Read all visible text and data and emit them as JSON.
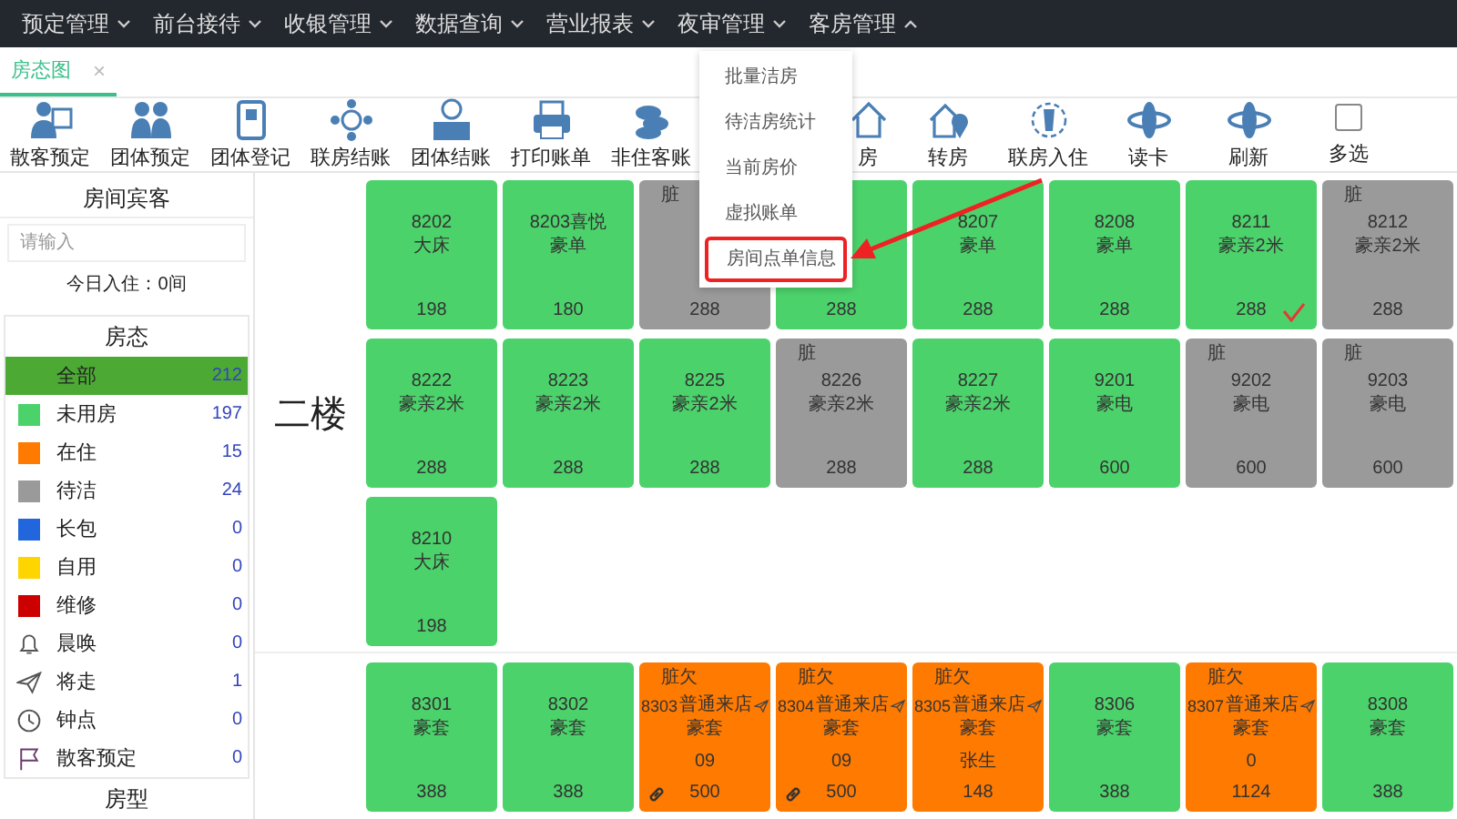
{
  "nav": [
    {
      "label": "预定管理",
      "expanded": false
    },
    {
      "label": "前台接待",
      "expanded": false
    },
    {
      "label": "收银管理",
      "expanded": false
    },
    {
      "label": "数据查询",
      "expanded": false
    },
    {
      "label": "营业报表",
      "expanded": false
    },
    {
      "label": "夜审管理",
      "expanded": false
    },
    {
      "label": "客房管理",
      "expanded": true
    }
  ],
  "tabs": [
    {
      "label": "房态图",
      "selected": true,
      "close": "×"
    }
  ],
  "toolbar": [
    {
      "kind": "button",
      "label": "散客预定"
    },
    {
      "kind": "button",
      "label": "团体预定"
    },
    {
      "kind": "button",
      "label": "团体登记"
    },
    {
      "kind": "button",
      "label": "联房结账"
    },
    {
      "kind": "button",
      "label": "团体结账"
    },
    {
      "kind": "button",
      "label": "打印账单"
    },
    {
      "kind": "button",
      "label": "非住客账"
    },
    {
      "kind": "button",
      "label": "房"
    },
    {
      "kind": "button",
      "label": "转房"
    },
    {
      "kind": "button",
      "label": "联房入住"
    },
    {
      "kind": "button",
      "label": "读卡"
    },
    {
      "kind": "button",
      "label": "刷新"
    },
    {
      "kind": "checkbox",
      "label": "多选",
      "checked": false
    }
  ],
  "menu": {
    "items": [
      {
        "label": "批量洁房",
        "annotated": false
      },
      {
        "label": "待洁房统计",
        "annotated": false
      },
      {
        "label": "当前房价",
        "annotated": false
      },
      {
        "label": "虚拟账单",
        "annotated": false
      },
      {
        "label": "房间点单信息",
        "annotated": true
      }
    ]
  },
  "annotations": [
    {
      "kind": "arrow"
    }
  ],
  "sidebar": {
    "title": "房间宾客",
    "search": {
      "placeholder": "请输入"
    },
    "today": "今日入住：0间",
    "status_title": "房态",
    "statuses": [
      {
        "kind": "plain",
        "label": "全部",
        "count": "212",
        "selected": true
      },
      {
        "kind": "swatch",
        "label": "未用房",
        "count": "197",
        "color": "#4cd26b",
        "selected": false
      },
      {
        "kind": "swatch",
        "label": "在住",
        "count": "15",
        "color": "#ff7a00",
        "selected": false
      },
      {
        "kind": "swatch",
        "label": "待洁",
        "count": "24",
        "color": "#9a9a9a",
        "selected": false
      },
      {
        "kind": "swatch",
        "label": "长包",
        "count": "0",
        "color": "#2266dd",
        "selected": false
      },
      {
        "kind": "swatch",
        "label": "自用",
        "count": "0",
        "color": "#ffd500",
        "selected": false
      },
      {
        "kind": "swatch",
        "label": "维修",
        "count": "0",
        "color": "#cc0000",
        "selected": false
      },
      {
        "kind": "bell",
        "label": "晨唤",
        "count": "0",
        "selected": false
      },
      {
        "kind": "plane",
        "label": "将走",
        "count": "1",
        "selected": false
      },
      {
        "kind": "clock",
        "label": "钟点",
        "count": "0",
        "selected": false
      },
      {
        "kind": "flag",
        "label": "散客预定",
        "count": "0",
        "selected": false
      }
    ],
    "type_title": "房型"
  },
  "floors": [
    {
      "label": "二楼",
      "rooms": [
        {
          "color": "#4cd26b",
          "number": "8202",
          "type": "大床",
          "price": "198"
        },
        {
          "color": "#4cd26b",
          "number": "8203喜悦",
          "type": "豪单",
          "price": "180"
        },
        {
          "color": "#9a9a9a",
          "tag": "脏",
          "price": "288"
        },
        {
          "color": "#4cd26b",
          "price": "288"
        },
        {
          "color": "#4cd26b",
          "number": "8207",
          "type": "豪单",
          "price": "288"
        },
        {
          "color": "#4cd26b",
          "number": "8208",
          "type": "豪单",
          "price": "288"
        },
        {
          "color": "#4cd26b",
          "number": "8211",
          "type": "豪亲2米",
          "price": "288",
          "checked": true
        },
        {
          "color": "#9a9a9a",
          "tag": "脏",
          "number": "8212",
          "type": "豪亲2米",
          "price": "288"
        },
        {
          "color": "#4cd26b",
          "number": "8222",
          "type": "豪亲2米",
          "price": "288"
        },
        {
          "color": "#4cd26b",
          "number": "8223",
          "type": "豪亲2米",
          "price": "288"
        },
        {
          "color": "#4cd26b",
          "number": "8225",
          "type": "豪亲2米",
          "price": "288"
        },
        {
          "color": "#9a9a9a",
          "tag": "脏",
          "number": "8226",
          "type": "豪亲2米",
          "price": "288"
        },
        {
          "color": "#4cd26b",
          "number": "8227",
          "type": "豪亲2米",
          "price": "288"
        },
        {
          "color": "#4cd26b",
          "number": "9201",
          "type": "豪电",
          "price": "600"
        },
        {
          "color": "#9a9a9a",
          "tag": "脏",
          "number": "9202",
          "type": "豪电",
          "price": "600"
        },
        {
          "color": "#9a9a9a",
          "tag": "脏",
          "number": "9203",
          "type": "豪电",
          "price": "600"
        },
        {
          "color": "#4cd26b",
          "number": "8210",
          "type": "大床",
          "price": "198"
        }
      ]
    },
    {
      "rooms": [
        {
          "color": "#4cd26b",
          "number": "8301",
          "type": "豪套",
          "price": "388"
        },
        {
          "color": "#4cd26b",
          "number": "8302",
          "type": "豪套",
          "price": "388"
        },
        {
          "color": "#ff7a00",
          "tag": "脏欠",
          "number": "8303",
          "source": "普通来店",
          "departing": true,
          "type": "豪套",
          "guest": "09",
          "linked": true,
          "price": "500"
        },
        {
          "color": "#ff7a00",
          "tag": "脏欠",
          "number": "8304",
          "source": "普通来店",
          "departing": true,
          "type": "豪套",
          "guest": "09",
          "linked": true,
          "price": "500"
        },
        {
          "color": "#ff7a00",
          "tag": "脏欠",
          "number": "8305",
          "source": "普通来店",
          "departing": true,
          "type": "豪套",
          "guest": "张生",
          "price": "148"
        },
        {
          "color": "#4cd26b",
          "number": "8306",
          "type": "豪套",
          "price": "388"
        },
        {
          "color": "#ff7a00",
          "tag": "脏欠",
          "number": "8307",
          "source": "普通来店",
          "departing": true,
          "type": "豪套",
          "guest": "0",
          "price": "1124"
        },
        {
          "color": "#4cd26b",
          "number": "8308",
          "type": "豪套",
          "price": "388"
        }
      ]
    }
  ]
}
